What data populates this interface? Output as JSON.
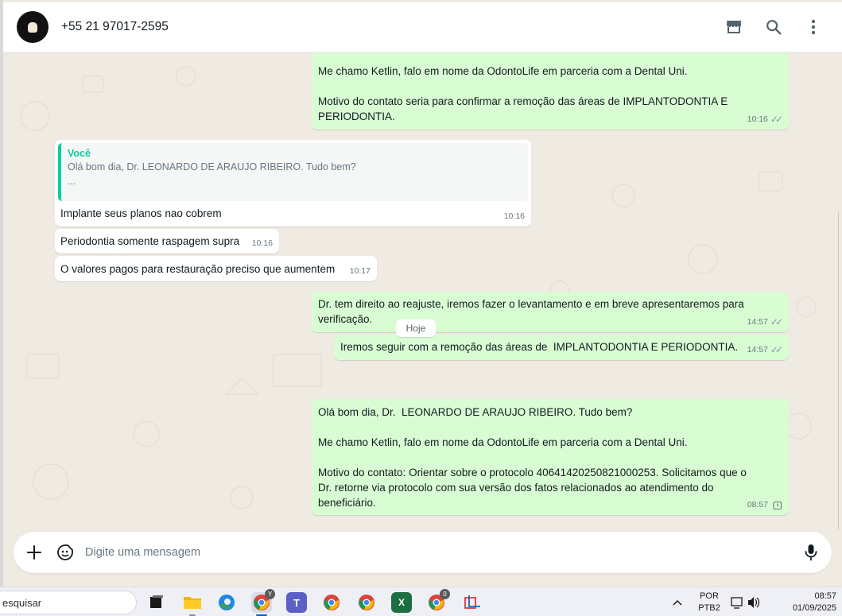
{
  "header": {
    "contact_name": "+55 21 97017-2595",
    "icons": [
      "store-icon",
      "search-icon",
      "menu-icon"
    ]
  },
  "messages": [
    {
      "direction": "out",
      "lines": "Me chamo Ketlin, falo em nome da OdontoLife em parceria com a Dental Uni.\n\nMotivo do contato seria para confirmar a remoção das áreas de IMPLANTODONTIA E\nPERIODONTIA.",
      "time": "10:16",
      "status": "read"
    },
    {
      "direction": "in",
      "quote_author": "Você",
      "quote_text": "Olá bom dia, Dr.  LEONARDO DE ARAUJO RIBEIRO. Tudo bem?",
      "quote_more": "...",
      "text": "Implante seus planos nao cobrem",
      "time": "10:16"
    },
    {
      "direction": "in",
      "text": "Periodontia somente raspagem supra",
      "time": "10:16"
    },
    {
      "direction": "in",
      "text": "O valores pagos para restauração preciso que aumentem",
      "time": "10:17"
    },
    {
      "direction": "out",
      "lines": "Dr. tem direito ao reajuste, iremos fazer o levantamento e em breve apresentaremos para\nverificação.",
      "time": "14:57",
      "status": "read"
    },
    {
      "direction": "out",
      "lines": "Iremos seguir com a remoção das áreas de  IMPLANTODONTIA E PERIODONTIA.",
      "time": "14:57",
      "status": "read"
    },
    {
      "direction": "out",
      "lines": "Olá bom dia, Dr.  LEONARDO DE ARAUJO RIBEIRO. Tudo bem?\n\nMe chamo Ketlin, falo em nome da OdontoLife em parceria com a Dental Uni.\n\nMotivo do contato: Orientar sobre o protocolo 40641420250821000253. Solicitamos que o\nDr. retorne via protocolo com sua versão dos fatos relacionados ao atendimento do\nbeneficiário.",
      "time": "08:57",
      "status": "pending"
    }
  ],
  "day_chip": "Hoje",
  "composer": {
    "placeholder": "Digite uma mensagem"
  },
  "taskbar": {
    "search_text": "esquisar",
    "lang_top": "POR",
    "lang_bottom": "PTB2",
    "time": "08:57",
    "date": "01/09/2025",
    "badges": [
      "Y",
      "0"
    ]
  }
}
